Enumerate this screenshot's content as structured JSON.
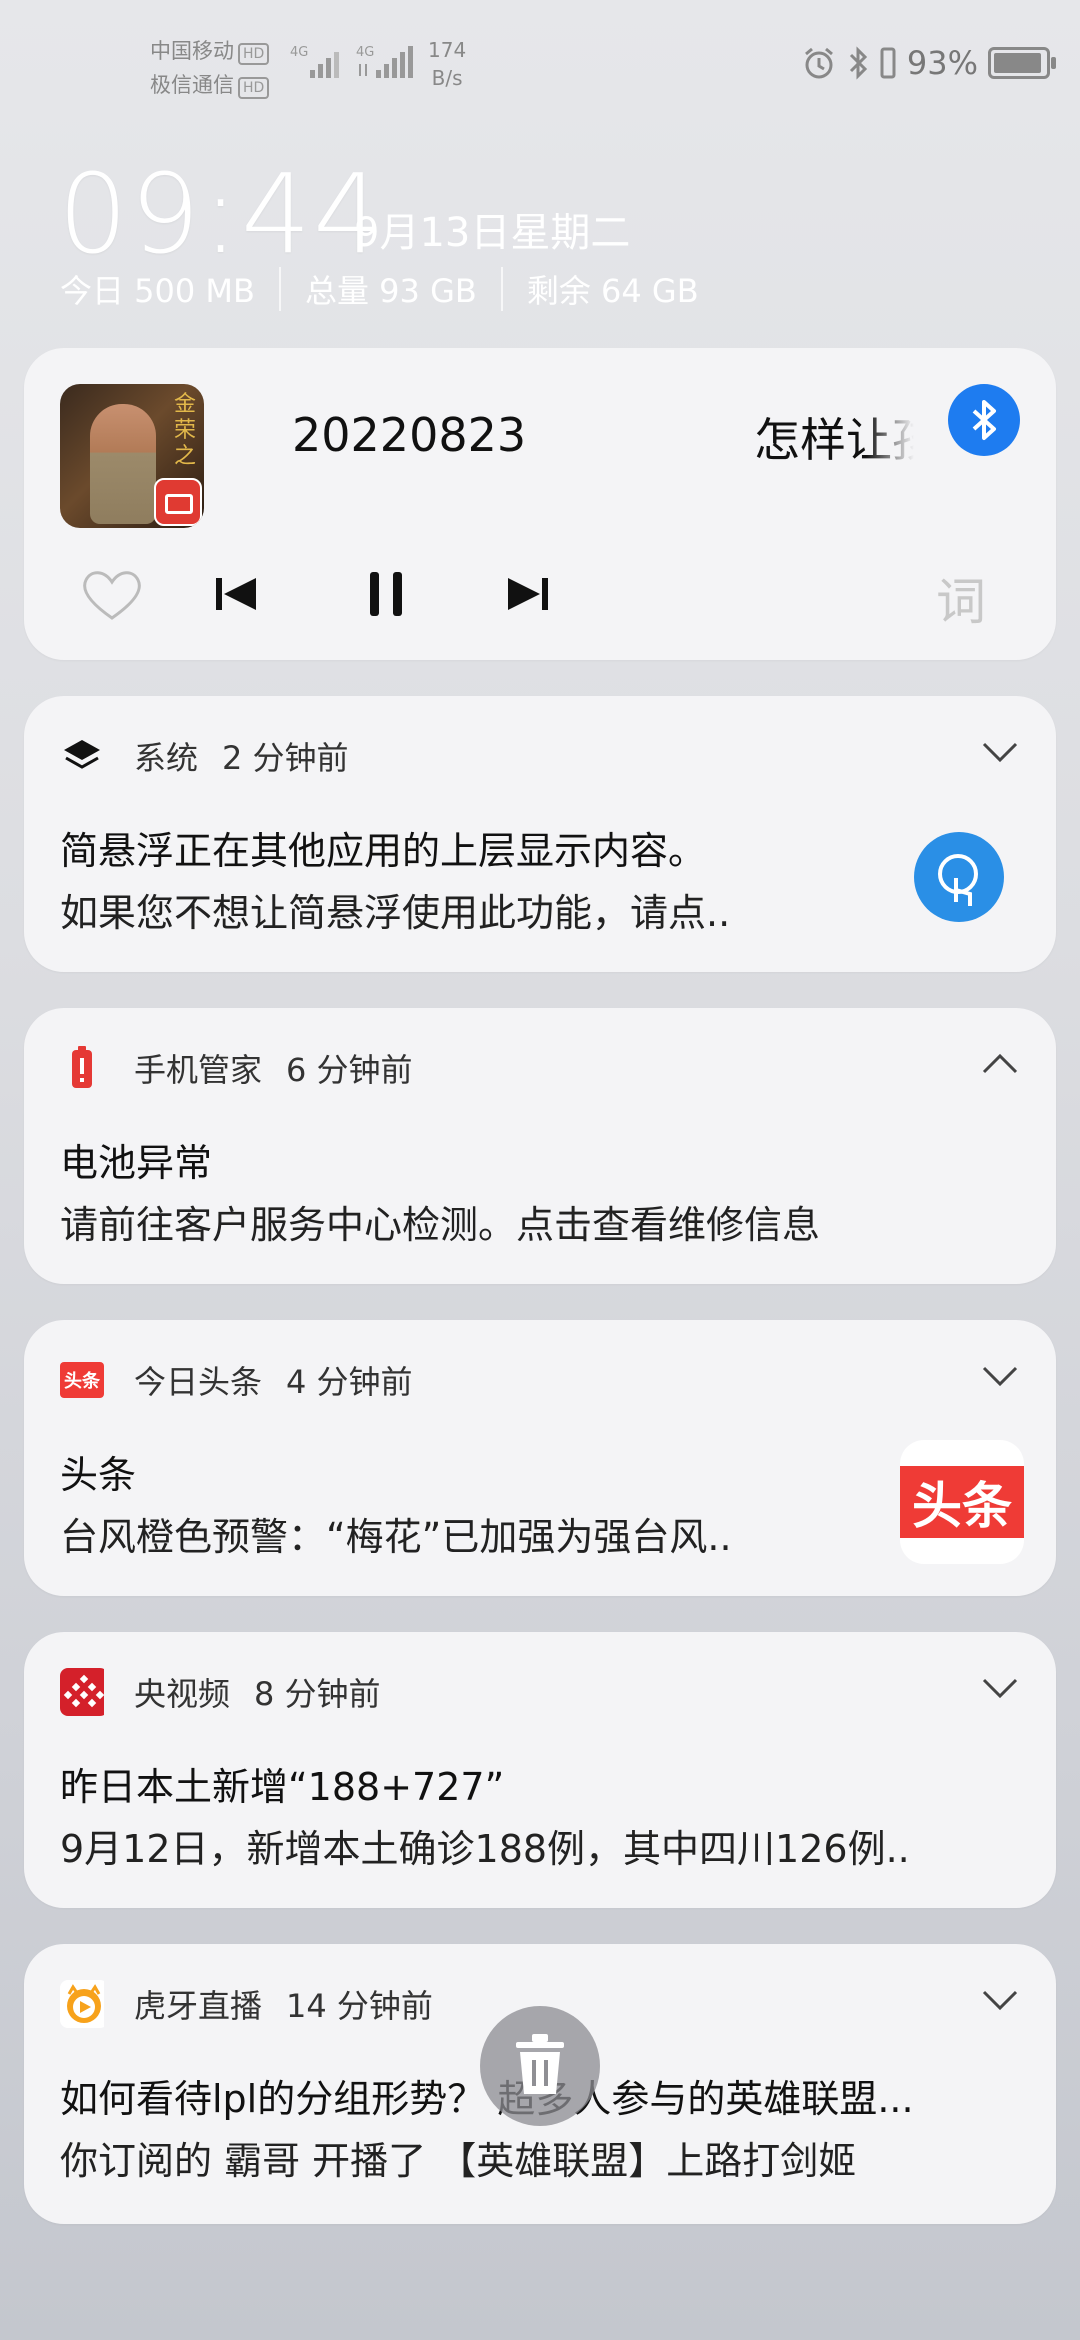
{
  "status_bar": {
    "carrier1": "中国移动",
    "carrier2": "极信通信",
    "hd": "HD",
    "network1": "4G",
    "network2": "4G",
    "speed_value": "174",
    "speed_unit": "B/s",
    "battery_percent": "93%",
    "battery_level": 0.93
  },
  "lockscreen": {
    "time": "09:44",
    "date": "9月13日星期二",
    "data_today": "今日 500 MB",
    "data_total": "总量 93 GB",
    "data_remaining": "剩余 64 GB"
  },
  "media": {
    "album_calligraphy": "金\n荣\n之",
    "title": "20220823",
    "subtitle": "怎样让孩",
    "lyrics_label": "词"
  },
  "notifications": [
    {
      "app": "系统",
      "time": "2 分钟前",
      "title": "简悬浮正在其他应用的上层显示内容。",
      "body": "如果您不想让简悬浮使用此功能，请点.."
    },
    {
      "app": "手机管家",
      "time": "6 分钟前",
      "title": "电池异常",
      "body": "请前往客户服务中心检测。点击查看维修信息"
    },
    {
      "app": "今日头条",
      "time": "4 分钟前",
      "title": "头条",
      "body": "台风橙色预警：“梅花”已加强为强台风..",
      "icon_text": "头条",
      "thumb_text": "头条"
    },
    {
      "app": "央视频",
      "time": "8 分钟前",
      "title": "昨日本土新增“188+727”",
      "body": "9月12日，新增本土确诊188例，其中四川126例.."
    },
    {
      "app": "虎牙直播",
      "time": "14 分钟前",
      "title": "如何看待lpl的分组形势？ 超多人参与的英雄联盟...",
      "body": "你订阅的 霸哥 开播了 【英雄联盟】上路打剑姬"
    }
  ],
  "colors": {
    "accent_blue": "#1e7cf0",
    "battery_red": "#e53935",
    "toutiao_red": "#ef3b36",
    "cctv_red": "#d4202a",
    "huya_orange": "#f7a21b"
  }
}
